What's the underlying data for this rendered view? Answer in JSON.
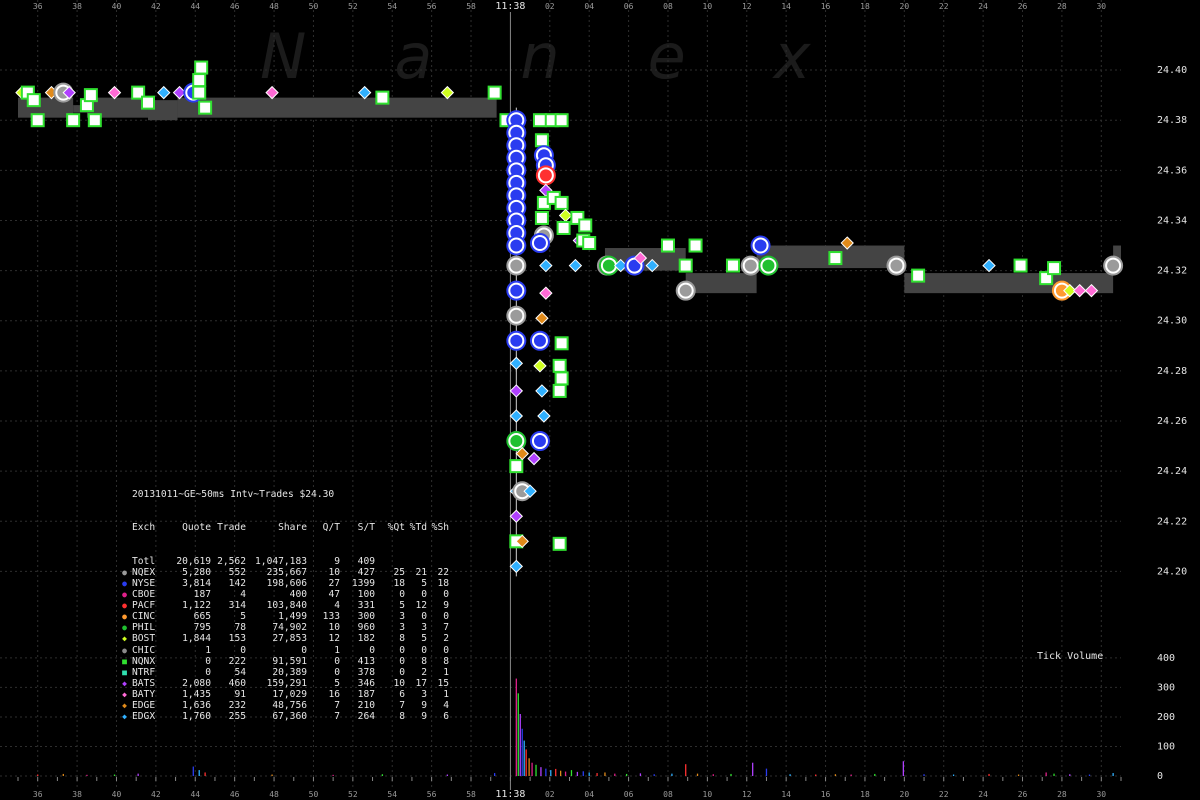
{
  "watermark": "Nanex",
  "chart_data": {
    "type": "scatter",
    "title": "20131011~GE~50ms Intv~Trades $24.30",
    "y_price_ticks": [
      "24.40",
      "24.38",
      "24.36",
      "24.34",
      "24.32",
      "24.30",
      "24.28",
      "24.26",
      "24.24",
      "24.22",
      "24.20"
    ],
    "y_volume_ticks": [
      "400",
      "300",
      "200",
      "100",
      "0"
    ],
    "volume_title": "Tick Volume",
    "x_ticks": [
      "36",
      "38",
      "40",
      "42",
      "44",
      "46",
      "48",
      "50",
      "52",
      "54",
      "56",
      "58",
      "11:38",
      "02",
      "04",
      "06",
      "08",
      "10",
      "12",
      "14",
      "16",
      "18",
      "20",
      "22",
      "24",
      "26",
      "28",
      "30"
    ],
    "x_domain": [
      -25,
      31
    ],
    "price_domain": [
      24.187,
      24.408
    ],
    "volume_domain": [
      0,
      420
    ],
    "center_label": "11:38",
    "nbbo_bands": [
      {
        "x0": -25,
        "x1": -22.2,
        "lo": 24.381,
        "hi": 24.389
      },
      {
        "x0": -22.2,
        "x1": -21.5,
        "lo": 24.383,
        "hi": 24.386
      },
      {
        "x0": -21.5,
        "x1": -18.4,
        "lo": 24.381,
        "hi": 24.389
      },
      {
        "x0": -18.4,
        "x1": -16.9,
        "lo": 24.38,
        "hi": 24.388
      },
      {
        "x0": -16.9,
        "x1": -0.7,
        "lo": 24.381,
        "hi": 24.389
      },
      {
        "x0": 4.8,
        "x1": 8.9,
        "lo": 24.32,
        "hi": 24.329
      },
      {
        "x0": 8.9,
        "x1": 12.5,
        "lo": 24.311,
        "hi": 24.319
      },
      {
        "x0": 12.5,
        "x1": 20.0,
        "lo": 24.321,
        "hi": 24.33
      },
      {
        "x0": 20.0,
        "x1": 30.6,
        "lo": 24.311,
        "hi": 24.319
      },
      {
        "x0": 30.6,
        "x1": 31,
        "lo": 24.321,
        "hi": 24.33
      }
    ],
    "trades": [
      {
        "x": -24.8,
        "y": 24.391,
        "ex": "BOST"
      },
      {
        "x": -24.5,
        "y": 24.391,
        "ex": "NQNX"
      },
      {
        "x": -24.2,
        "y": 24.388,
        "ex": "NQNX"
      },
      {
        "x": -24.0,
        "y": 24.38,
        "ex": "NQNX"
      },
      {
        "x": -23.3,
        "y": 24.391,
        "ex": "EDGE"
      },
      {
        "x": -22.7,
        "y": 24.391,
        "ex": "NQEX"
      },
      {
        "x": -22.4,
        "y": 24.391,
        "ex": "BATS"
      },
      {
        "x": -22.2,
        "y": 24.38,
        "ex": "NQNX"
      },
      {
        "x": -21.5,
        "y": 24.386,
        "ex": "NQNX"
      },
      {
        "x": -21.3,
        "y": 24.39,
        "ex": "NQNX"
      },
      {
        "x": -21.1,
        "y": 24.38,
        "ex": "NQNX"
      },
      {
        "x": -20.1,
        "y": 24.391,
        "ex": "BATY"
      },
      {
        "x": -18.9,
        "y": 24.391,
        "ex": "NQNX"
      },
      {
        "x": -18.4,
        "y": 24.387,
        "ex": "NQNX"
      },
      {
        "x": -17.6,
        "y": 24.391,
        "ex": "EDGX"
      },
      {
        "x": -16.8,
        "y": 24.391,
        "ex": "BATS"
      },
      {
        "x": -16.1,
        "y": 24.391,
        "ex": "NYSE"
      },
      {
        "x": -15.8,
        "y": 24.391,
        "ex": "NQNX"
      },
      {
        "x": -15.8,
        "y": 24.396,
        "ex": "NQNX"
      },
      {
        "x": -15.7,
        "y": 24.401,
        "ex": "NQNX"
      },
      {
        "x": -15.5,
        "y": 24.385,
        "ex": "NQNX"
      },
      {
        "x": -12.1,
        "y": 24.391,
        "ex": "BATY"
      },
      {
        "x": -7.4,
        "y": 24.391,
        "ex": "EDGX"
      },
      {
        "x": -6.5,
        "y": 24.389,
        "ex": "NQNX"
      },
      {
        "x": -3.2,
        "y": 24.391,
        "ex": "BOST"
      },
      {
        "x": -0.8,
        "y": 24.391,
        "ex": "NQNX"
      },
      {
        "x": -0.2,
        "y": 24.38,
        "ex": "NQNX"
      },
      {
        "x": 0.3,
        "y": 24.38,
        "ex": "NYSE"
      },
      {
        "x": 0.3,
        "y": 24.375,
        "ex": "NYSE"
      },
      {
        "x": 0.3,
        "y": 24.37,
        "ex": "NYSE"
      },
      {
        "x": 0.3,
        "y": 24.365,
        "ex": "NYSE"
      },
      {
        "x": 0.3,
        "y": 24.36,
        "ex": "NYSE"
      },
      {
        "x": 0.3,
        "y": 24.355,
        "ex": "NYSE"
      },
      {
        "x": 0.3,
        "y": 24.35,
        "ex": "NYSE"
      },
      {
        "x": 0.3,
        "y": 24.345,
        "ex": "NYSE"
      },
      {
        "x": 0.3,
        "y": 24.34,
        "ex": "NYSE"
      },
      {
        "x": 0.3,
        "y": 24.335,
        "ex": "NYSE"
      },
      {
        "x": 0.3,
        "y": 24.33,
        "ex": "NYSE"
      },
      {
        "x": 0.3,
        "y": 24.322,
        "ex": "NQEX"
      },
      {
        "x": 0.3,
        "y": 24.312,
        "ex": "NYSE"
      },
      {
        "x": 0.3,
        "y": 24.302,
        "ex": "NQEX"
      },
      {
        "x": 0.3,
        "y": 24.292,
        "ex": "NYSE"
      },
      {
        "x": 0.3,
        "y": 24.283,
        "ex": "EDGX"
      },
      {
        "x": 0.3,
        "y": 24.272,
        "ex": "BATS"
      },
      {
        "x": 0.3,
        "y": 24.262,
        "ex": "EDGX"
      },
      {
        "x": 0.3,
        "y": 24.252,
        "ex": "PHIL"
      },
      {
        "x": 0.3,
        "y": 24.242,
        "ex": "NQNX"
      },
      {
        "x": 0.3,
        "y": 24.232,
        "ex": "EDGX"
      },
      {
        "x": 0.3,
        "y": 24.222,
        "ex": "BATS"
      },
      {
        "x": 0.3,
        "y": 24.212,
        "ex": "NQNX"
      },
      {
        "x": 0.3,
        "y": 24.202,
        "ex": "EDGX"
      },
      {
        "x": 0.6,
        "y": 24.247,
        "ex": "EDGE"
      },
      {
        "x": 0.6,
        "y": 24.232,
        "ex": "NQEX"
      },
      {
        "x": 0.6,
        "y": 24.212,
        "ex": "EDGE"
      },
      {
        "x": 1.5,
        "y": 24.38,
        "ex": "NQNX"
      },
      {
        "x": 2.1,
        "y": 24.38,
        "ex": "NQNX"
      },
      {
        "x": 1.6,
        "y": 24.372,
        "ex": "NQNX"
      },
      {
        "x": 1.7,
        "y": 24.366,
        "ex": "NYSE"
      },
      {
        "x": 1.8,
        "y": 24.362,
        "ex": "NYSE"
      },
      {
        "x": 1.8,
        "y": 24.358,
        "ex": "PACF"
      },
      {
        "x": 1.8,
        "y": 24.352,
        "ex": "BATS"
      },
      {
        "x": 1.7,
        "y": 24.347,
        "ex": "NQNX"
      },
      {
        "x": 1.6,
        "y": 24.341,
        "ex": "NQNX"
      },
      {
        "x": 1.7,
        "y": 24.334,
        "ex": "NQEX"
      },
      {
        "x": 1.5,
        "y": 24.331,
        "ex": "NYSE"
      },
      {
        "x": 1.8,
        "y": 24.322,
        "ex": "EDGX"
      },
      {
        "x": 1.8,
        "y": 24.311,
        "ex": "BATY"
      },
      {
        "x": 1.6,
        "y": 24.301,
        "ex": "EDGE"
      },
      {
        "x": 1.5,
        "y": 24.292,
        "ex": "NYSE"
      },
      {
        "x": 1.5,
        "y": 24.282,
        "ex": "BOST"
      },
      {
        "x": 1.6,
        "y": 24.272,
        "ex": "EDGX"
      },
      {
        "x": 1.7,
        "y": 24.262,
        "ex": "EDGX"
      },
      {
        "x": 1.5,
        "y": 24.252,
        "ex": "NYSE"
      },
      {
        "x": 1.2,
        "y": 24.245,
        "ex": "BATS"
      },
      {
        "x": 1.0,
        "y": 24.232,
        "ex": "EDGX"
      },
      {
        "x": 2.6,
        "y": 24.38,
        "ex": "NQNX"
      },
      {
        "x": 2.2,
        "y": 24.349,
        "ex": "NQNX"
      },
      {
        "x": 2.6,
        "y": 24.347,
        "ex": "NQNX"
      },
      {
        "x": 2.8,
        "y": 24.342,
        "ex": "BOST"
      },
      {
        "x": 2.7,
        "y": 24.337,
        "ex": "NQNX"
      },
      {
        "x": 3.4,
        "y": 24.341,
        "ex": "NQNX"
      },
      {
        "x": 3.8,
        "y": 24.338,
        "ex": "NQNX"
      },
      {
        "x": 3.5,
        "y": 24.332,
        "ex": "BATS"
      },
      {
        "x": 3.7,
        "y": 24.332,
        "ex": "NQNX"
      },
      {
        "x": 3.3,
        "y": 24.322,
        "ex": "EDGX"
      },
      {
        "x": 2.6,
        "y": 24.291,
        "ex": "NQNX"
      },
      {
        "x": 2.5,
        "y": 24.282,
        "ex": "NQNX"
      },
      {
        "x": 2.6,
        "y": 24.277,
        "ex": "NQNX"
      },
      {
        "x": 2.5,
        "y": 24.272,
        "ex": "NQNX"
      },
      {
        "x": 2.5,
        "y": 24.211,
        "ex": "NQNX"
      },
      {
        "x": 4.0,
        "y": 24.331,
        "ex": "NQNX"
      },
      {
        "x": 4.9,
        "y": 24.322,
        "ex": "NQEX"
      },
      {
        "x": 5.0,
        "y": 24.322,
        "ex": "PHIL"
      },
      {
        "x": 5.6,
        "y": 24.322,
        "ex": "EDGX"
      },
      {
        "x": 6.3,
        "y": 24.322,
        "ex": "NYSE"
      },
      {
        "x": 6.6,
        "y": 24.325,
        "ex": "BATY"
      },
      {
        "x": 7.2,
        "y": 24.322,
        "ex": "EDGX"
      },
      {
        "x": 8.0,
        "y": 24.33,
        "ex": "NQNX"
      },
      {
        "x": 8.9,
        "y": 24.322,
        "ex": "NQNX"
      },
      {
        "x": 8.9,
        "y": 24.312,
        "ex": "NQEX"
      },
      {
        "x": 9.4,
        "y": 24.33,
        "ex": "NQNX"
      },
      {
        "x": 11.3,
        "y": 24.322,
        "ex": "NQNX"
      },
      {
        "x": 12.2,
        "y": 24.322,
        "ex": "NQEX"
      },
      {
        "x": 12.7,
        "y": 24.33,
        "ex": "NYSE"
      },
      {
        "x": 13.1,
        "y": 24.322,
        "ex": "PHIL"
      },
      {
        "x": 16.5,
        "y": 24.325,
        "ex": "NQNX"
      },
      {
        "x": 17.1,
        "y": 24.331,
        "ex": "EDGE"
      },
      {
        "x": 19.6,
        "y": 24.322,
        "ex": "NQEX"
      },
      {
        "x": 20.7,
        "y": 24.318,
        "ex": "NQNX"
      },
      {
        "x": 24.3,
        "y": 24.322,
        "ex": "EDGX"
      },
      {
        "x": 25.9,
        "y": 24.322,
        "ex": "NQNX"
      },
      {
        "x": 27.2,
        "y": 24.317,
        "ex": "NQNX"
      },
      {
        "x": 27.6,
        "y": 24.321,
        "ex": "NQNX"
      },
      {
        "x": 28.0,
        "y": 24.312,
        "ex": "CINC"
      },
      {
        "x": 28.4,
        "y": 24.312,
        "ex": "BOST"
      },
      {
        "x": 28.9,
        "y": 24.312,
        "ex": "BATY"
      },
      {
        "x": 29.5,
        "y": 24.312,
        "ex": "BATY"
      },
      {
        "x": 30.6,
        "y": 24.322,
        "ex": "NQEX"
      }
    ],
    "volume_spikes": [
      {
        "x": 0.3,
        "v": 330
      },
      {
        "x": 0.4,
        "v": 280
      },
      {
        "x": 0.5,
        "v": 210
      },
      {
        "x": 0.6,
        "v": 160
      },
      {
        "x": 0.7,
        "v": 120
      },
      {
        "x": 0.8,
        "v": 90
      },
      {
        "x": 0.95,
        "v": 60
      },
      {
        "x": 1.1,
        "v": 45
      },
      {
        "x": 1.3,
        "v": 38
      },
      {
        "x": 1.55,
        "v": 30
      },
      {
        "x": 1.8,
        "v": 25
      },
      {
        "x": 2.05,
        "v": 20
      },
      {
        "x": 2.3,
        "v": 24
      },
      {
        "x": 2.55,
        "v": 18
      },
      {
        "x": 2.8,
        "v": 15
      },
      {
        "x": 3.1,
        "v": 20
      },
      {
        "x": 3.4,
        "v": 14
      },
      {
        "x": 3.7,
        "v": 16
      },
      {
        "x": 4.0,
        "v": 12
      },
      {
        "x": 4.4,
        "v": 10
      },
      {
        "x": 4.8,
        "v": 12
      },
      {
        "x": 5.3,
        "v": 8
      },
      {
        "x": 5.9,
        "v": 7
      },
      {
        "x": 6.6,
        "v": 9
      },
      {
        "x": 7.3,
        "v": 6
      },
      {
        "x": 8.2,
        "v": 8
      },
      {
        "x": 8.9,
        "v": 40
      },
      {
        "x": 9.5,
        "v": 8
      },
      {
        "x": 10.3,
        "v": 6
      },
      {
        "x": 11.2,
        "v": 7
      },
      {
        "x": 12.3,
        "v": 45
      },
      {
        "x": 13.0,
        "v": 25
      },
      {
        "x": 14.2,
        "v": 6
      },
      {
        "x": 15.5,
        "v": 5
      },
      {
        "x": 16.5,
        "v": 6
      },
      {
        "x": 17.3,
        "v": 5
      },
      {
        "x": 18.5,
        "v": 7
      },
      {
        "x": 19.95,
        "v": 50
      },
      {
        "x": 21.0,
        "v": 6
      },
      {
        "x": 22.5,
        "v": 5
      },
      {
        "x": 24.3,
        "v": 7
      },
      {
        "x": 25.8,
        "v": 5
      },
      {
        "x": 27.2,
        "v": 12
      },
      {
        "x": 27.6,
        "v": 8
      },
      {
        "x": 28.4,
        "v": 6
      },
      {
        "x": 29.4,
        "v": 5
      },
      {
        "x": 30.6,
        "v": 10
      },
      {
        "x": -24.0,
        "v": 5
      },
      {
        "x": -22.7,
        "v": 7
      },
      {
        "x": -21.5,
        "v": 4
      },
      {
        "x": -20.1,
        "v": 5
      },
      {
        "x": -18.9,
        "v": 8
      },
      {
        "x": -16.1,
        "v": 32
      },
      {
        "x": -15.8,
        "v": 20
      },
      {
        "x": -15.5,
        "v": 12
      },
      {
        "x": -12.1,
        "v": 5
      },
      {
        "x": -9.0,
        "v": 4
      },
      {
        "x": -6.5,
        "v": 6
      },
      {
        "x": -3.2,
        "v": 5
      },
      {
        "x": -0.8,
        "v": 10
      }
    ],
    "legend_colors": {
      "NQEX": "#9b9b9b",
      "NYSE": "#2a3cf0",
      "CBOE": "#e0208a",
      "PACF": "#ff3030",
      "CINC": "#ff9a30",
      "PHIL": "#20c030",
      "BOST": "#d0ff20",
      "CHIC": "#8a8a8a",
      "NQNX": "#30e030",
      "NTRF": "#30e0b0",
      "BATS": "#b040ff",
      "BATY": "#ff6ad5",
      "EDGE": "#e08a1a",
      "EDGX": "#30b0ff"
    }
  },
  "stats_table": {
    "header": [
      "Exch",
      "Quote",
      "Trade",
      "Share",
      "Q/T",
      "S/T",
      "%Qt",
      "%Td",
      "%Sh"
    ],
    "rows": [
      {
        "exch": "Totl",
        "quote": "20,619",
        "trade": "2,562",
        "share": "1,047,183",
        "qt": "9",
        "st": "409",
        "pq": "",
        "pt": "",
        "ps": "",
        "symbol": "",
        "color": "#e6e6e6"
      },
      {
        "exch": "NQEX",
        "quote": "5,280",
        "trade": "552",
        "share": "235,667",
        "qt": "10",
        "st": "427",
        "pq": "25",
        "pt": "21",
        "ps": "22",
        "symbol": "●",
        "color": "#9b9b9b"
      },
      {
        "exch": "NYSE",
        "quote": "3,814",
        "trade": "142",
        "share": "198,606",
        "qt": "27",
        "st": "1399",
        "pq": "18",
        "pt": "5",
        "ps": "18",
        "symbol": "●",
        "color": "#2a3cf0"
      },
      {
        "exch": "CBOE",
        "quote": "187",
        "trade": "4",
        "share": "400",
        "qt": "47",
        "st": "100",
        "pq": "0",
        "pt": "0",
        "ps": "0",
        "symbol": "●",
        "color": "#e0208a"
      },
      {
        "exch": "PACF",
        "quote": "1,122",
        "trade": "314",
        "share": "103,840",
        "qt": "4",
        "st": "331",
        "pq": "5",
        "pt": "12",
        "ps": "9",
        "symbol": "●",
        "color": "#ff3030"
      },
      {
        "exch": "CINC",
        "quote": "665",
        "trade": "5",
        "share": "1,499",
        "qt": "133",
        "st": "300",
        "pq": "3",
        "pt": "0",
        "ps": "0",
        "symbol": "●",
        "color": "#ff9a30"
      },
      {
        "exch": "PHIL",
        "quote": "795",
        "trade": "78",
        "share": "74,902",
        "qt": "10",
        "st": "960",
        "pq": "3",
        "pt": "3",
        "ps": "7",
        "symbol": "●",
        "color": "#20c030"
      },
      {
        "exch": "BOST",
        "quote": "1,844",
        "trade": "153",
        "share": "27,853",
        "qt": "12",
        "st": "182",
        "pq": "8",
        "pt": "5",
        "ps": "2",
        "symbol": "◆",
        "color": "#d0ff20"
      },
      {
        "exch": "CHIC",
        "quote": "1",
        "trade": "0",
        "share": "0",
        "qt": "1",
        "st": "0",
        "pq": "0",
        "pt": "0",
        "ps": "0",
        "symbol": "●",
        "color": "#8a8a8a"
      },
      {
        "exch": "NQNX",
        "quote": "0",
        "trade": "222",
        "share": "91,591",
        "qt": "0",
        "st": "413",
        "pq": "0",
        "pt": "8",
        "ps": "8",
        "symbol": "■",
        "color": "#30e030"
      },
      {
        "exch": "NTRF",
        "quote": "0",
        "trade": "54",
        "share": "20,389",
        "qt": "0",
        "st": "378",
        "pq": "0",
        "pt": "2",
        "ps": "1",
        "symbol": "■",
        "color": "#30e0b0"
      },
      {
        "exch": "BATS",
        "quote": "2,080",
        "trade": "460",
        "share": "159,291",
        "qt": "5",
        "st": "346",
        "pq": "10",
        "pt": "17",
        "ps": "15",
        "symbol": "◆",
        "color": "#b040ff"
      },
      {
        "exch": "BATY",
        "quote": "1,435",
        "trade": "91",
        "share": "17,029",
        "qt": "16",
        "st": "187",
        "pq": "6",
        "pt": "3",
        "ps": "1",
        "symbol": "◆",
        "color": "#ff6ad5"
      },
      {
        "exch": "EDGE",
        "quote": "1,636",
        "trade": "232",
        "share": "48,756",
        "qt": "7",
        "st": "210",
        "pq": "7",
        "pt": "9",
        "ps": "4",
        "symbol": "◆",
        "color": "#e08a1a"
      },
      {
        "exch": "EDGX",
        "quote": "1,760",
        "trade": "255",
        "share": "67,360",
        "qt": "7",
        "st": "264",
        "pq": "8",
        "pt": "9",
        "ps": "6",
        "symbol": "◆",
        "color": "#30b0ff"
      }
    ]
  }
}
